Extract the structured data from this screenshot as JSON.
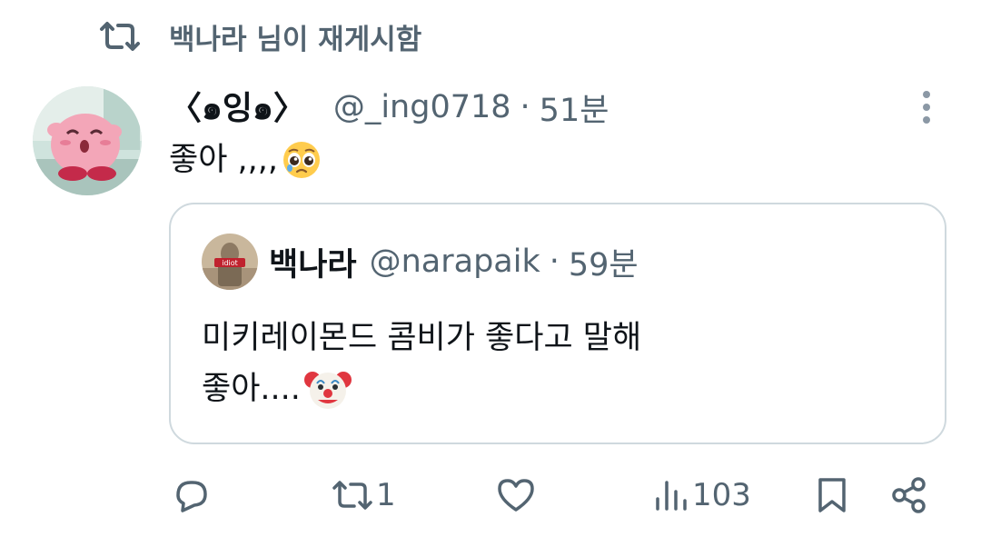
{
  "retweet_banner": {
    "icon": "retweet-icon",
    "text": "백나라 님이 재게시함"
  },
  "tweet": {
    "display_name": "〈๑잉๑〉",
    "handle": "@_ing0718",
    "separator": "·",
    "time": "51분",
    "text": "좋아 ,,,,",
    "emoji": "pleading-face-emoji"
  },
  "quoted_tweet": {
    "display_name": "백나라",
    "handle": "@narapaik",
    "separator": "·",
    "time": "59분",
    "avatar_badge": "idiot",
    "lines": [
      "미키레이몬드 콤비가 좋다고 말해",
      "좋아...."
    ],
    "emoji": "clown-face-emoji"
  },
  "actions": {
    "reply": {
      "icon": "reply-icon",
      "count": ""
    },
    "retweet": {
      "icon": "retweet-icon",
      "count": "1"
    },
    "like": {
      "icon": "heart-icon",
      "count": ""
    },
    "views": {
      "icon": "views-icon",
      "count": "103"
    },
    "bookmark": {
      "icon": "bookmark-icon"
    },
    "share": {
      "icon": "share-icon"
    }
  },
  "colors": {
    "muted": "#536471",
    "text": "#0f1419",
    "border": "#cfd9de",
    "kirby": "#f3a6b8"
  }
}
